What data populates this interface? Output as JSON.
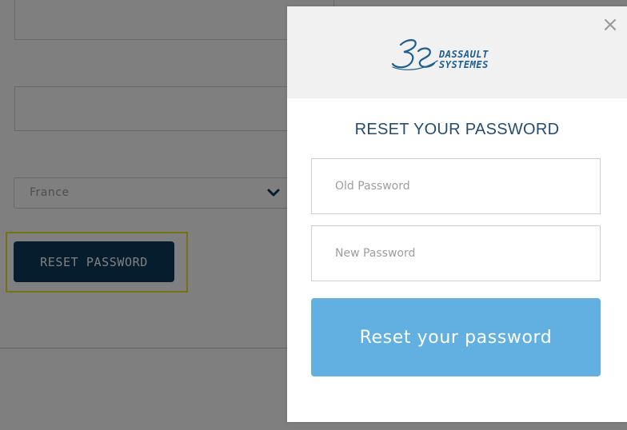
{
  "background_form": {
    "country_select": {
      "value": "France"
    },
    "reset_password_button_label": "RESET PASSWORD"
  },
  "modal": {
    "close_label": "×",
    "logo": {
      "line1": "DASSAULT",
      "line2": "SYSTEMES"
    },
    "title": "RESET YOUR PASSWORD",
    "old_password": {
      "placeholder": "Old Password",
      "value": ""
    },
    "new_password": {
      "placeholder": "New Password",
      "value": ""
    },
    "submit_label": "Reset your password"
  },
  "colors": {
    "primary_dark": "#0c3a5d",
    "submit_blue": "#62afe1",
    "title_blue": "#254c6e",
    "highlight": "#e8e82a"
  },
  "icons": {
    "select_chevron": "chevron-down-icon",
    "close": "close-icon"
  }
}
